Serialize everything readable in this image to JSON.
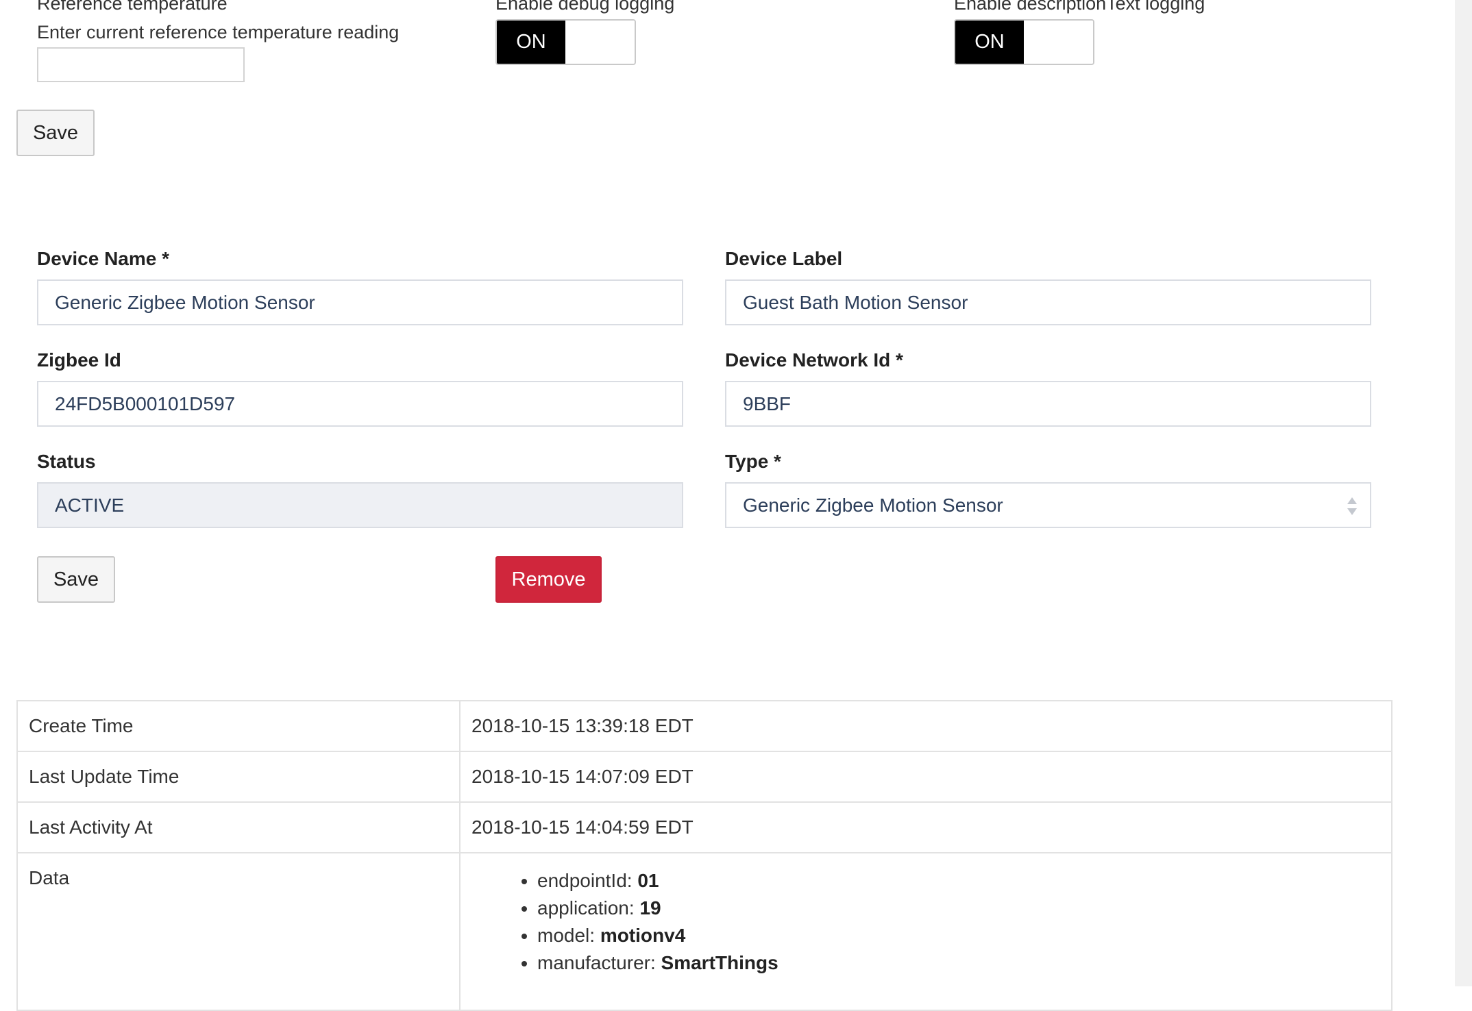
{
  "preferences": {
    "reference_temp": {
      "title": "Reference temperature",
      "description": "Enter current reference temperature reading",
      "value": ""
    },
    "debug_logging": {
      "title": "Enable debug logging",
      "state": "ON"
    },
    "desc_logging": {
      "title": "Enable descriptionText logging",
      "state": "ON"
    },
    "save_label": "Save"
  },
  "device": {
    "name_label": "Device Name *",
    "name_value": "Generic Zigbee Motion Sensor",
    "label_label": "Device Label",
    "label_value": "Guest Bath Motion Sensor",
    "zigbee_label": "Zigbee Id",
    "zigbee_value": "24FD5B000101D597",
    "network_label": "Device Network Id *",
    "network_value": "9BBF",
    "status_label": "Status",
    "status_value": "ACTIVE",
    "type_label": "Type *",
    "type_value": "Generic Zigbee Motion Sensor",
    "save_label": "Save",
    "remove_label": "Remove"
  },
  "info": {
    "create_label": "Create Time",
    "create_value": "2018-10-15 13:39:18 EDT",
    "update_label": "Last Update Time",
    "update_value": "2018-10-15 14:07:09 EDT",
    "activity_label": "Last Activity At",
    "activity_value": "2018-10-15 14:04:59 EDT",
    "data_label": "Data",
    "data_items": [
      {
        "key": "endpointId: ",
        "value": "01"
      },
      {
        "key": "application: ",
        "value": "19"
      },
      {
        "key": "model: ",
        "value": "motionv4"
      },
      {
        "key": "manufacturer: ",
        "value": "SmartThings"
      }
    ]
  },
  "colors": {
    "danger": "#d0263c",
    "toggle_on": "#000000",
    "input_text": "#2c3e5a"
  },
  "icons": {
    "select_arrows": "up-down-arrows-icon"
  }
}
